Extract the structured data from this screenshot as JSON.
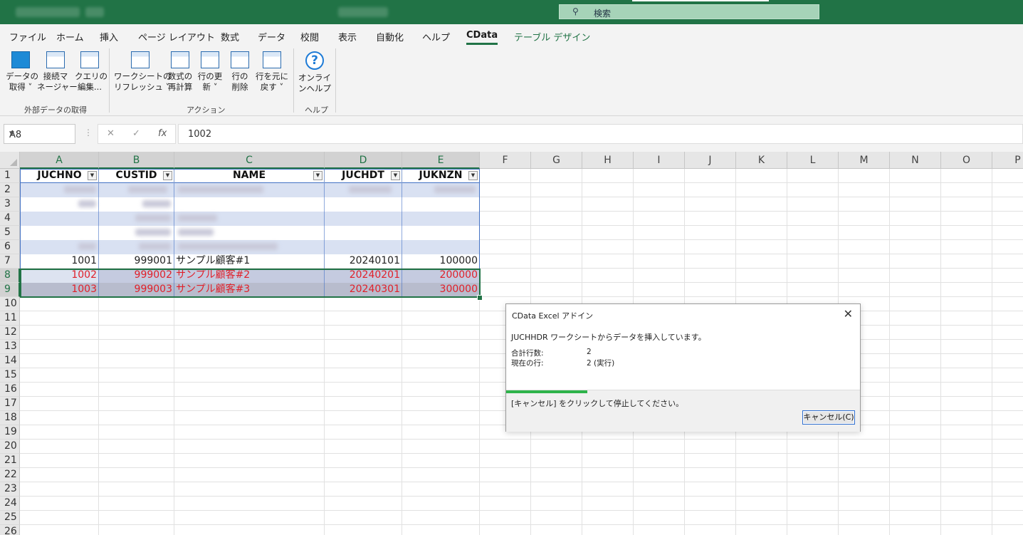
{
  "titlebar": {
    "search_placeholder": "検索",
    "icons": {
      "search": "search-icon"
    }
  },
  "ribbon_tabs": [
    {
      "label": "ファイル"
    },
    {
      "label": "ホーム"
    },
    {
      "label": "挿入"
    },
    {
      "label": "ページ レイアウト"
    },
    {
      "label": "数式"
    },
    {
      "label": "データ"
    },
    {
      "label": "校閲"
    },
    {
      "label": "表示"
    },
    {
      "label": "自動化"
    },
    {
      "label": "ヘルプ"
    },
    {
      "label": "CData",
      "active": true
    },
    {
      "label": "テーブル デザイン"
    }
  ],
  "ribbon": {
    "buttons": [
      {
        "line1": "データの",
        "line2": "取得 ˅"
      },
      {
        "line1": "接続マ",
        "line2": "ネージャー"
      },
      {
        "line1": "クエリの",
        "line2": "編集..."
      },
      {
        "line1": "ワークシートの",
        "line2": "リフレッシュ ˅"
      },
      {
        "line1": "数式の",
        "line2": "再計算"
      },
      {
        "line1": "行の更",
        "line2": "新 ˅"
      },
      {
        "line1": "行の",
        "line2": "削除"
      },
      {
        "line1": "行を元に",
        "line2": "戻す ˅"
      },
      {
        "line1": "オンライ",
        "line2": "ンヘルプ"
      }
    ],
    "groups": [
      "外部データの取得",
      "アクション",
      "ヘルプ"
    ]
  },
  "formula_bar": {
    "name_box": "A8",
    "cancel_glyph": "✕",
    "enter_glyph": "✓",
    "fx_glyph": "fx",
    "value": "1002"
  },
  "grid": {
    "columns": [
      "A",
      "B",
      "C",
      "D",
      "E",
      "F",
      "G",
      "H",
      "I",
      "J",
      "K",
      "L",
      "M",
      "N",
      "O",
      "P"
    ],
    "rows": [
      "1",
      "2",
      "3",
      "4",
      "5",
      "6",
      "7",
      "8",
      "9",
      "10",
      "11",
      "12",
      "13",
      "14",
      "15",
      "16",
      "17",
      "18",
      "19",
      "20",
      "21",
      "22",
      "23",
      "24",
      "25",
      "26"
    ],
    "table_headers": [
      "JUCHNO",
      "CUSTID",
      "NAME",
      "JUCHDT",
      "JUKNZN"
    ],
    "data_rows": [
      {
        "row": 7,
        "cells": [
          "1001",
          "999001",
          "サンプル顧客#1",
          "20240101",
          "100000"
        ],
        "highlight": false
      },
      {
        "row": 8,
        "cells": [
          "1002",
          "999002",
          "サンプル顧客#2",
          "20240201",
          "200000"
        ],
        "highlight": true
      },
      {
        "row": 9,
        "cells": [
          "1003",
          "999003",
          "サンプル顧客#3",
          "20240301",
          "300000"
        ],
        "highlight": true
      }
    ]
  },
  "dialog": {
    "title": "CData Excel アドイン",
    "message": "JUCHHDR ワークシートからデータを挿入しています。",
    "total_label": "合計行数:",
    "total_value": "2",
    "current_label": "現在の行:",
    "current_value": "2 (実行)",
    "progress": 0.23,
    "hint": "[キャンセル] をクリックして停止してください。",
    "cancel_label": "キャンセル(C)",
    "close_glyph": "✕"
  },
  "colors": {
    "accent": "#217346",
    "table_border": "#4472c4",
    "highlight_text": "#e0202a",
    "progress": "#2db34a"
  }
}
